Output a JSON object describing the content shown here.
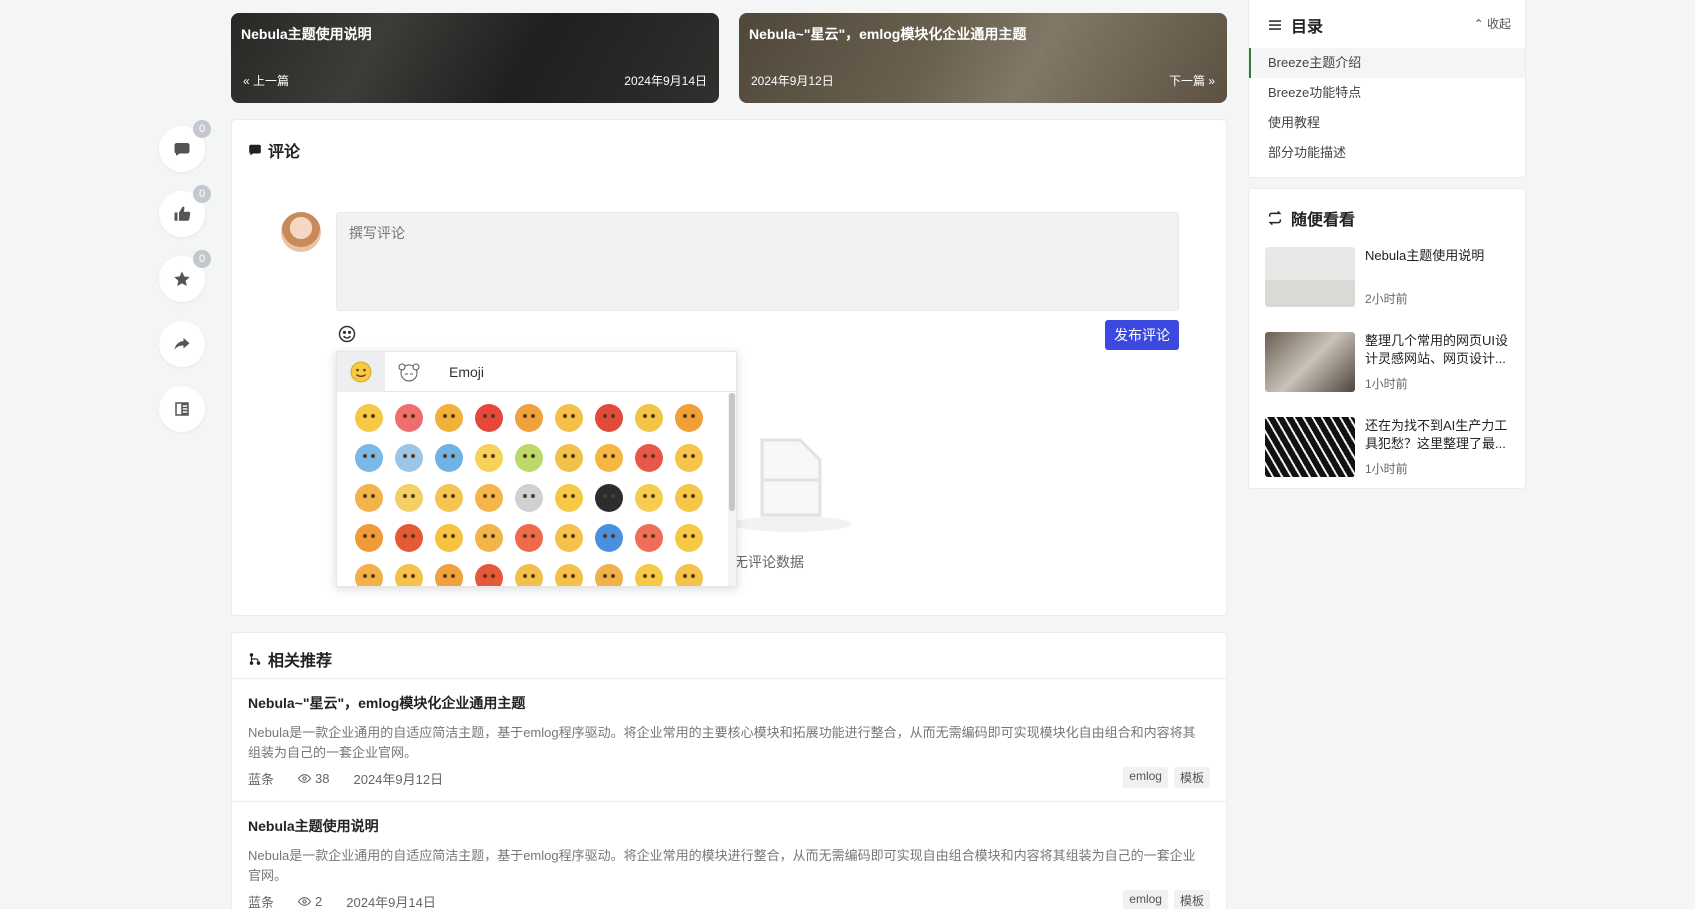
{
  "side_actions": [
    {
      "icon": "comment-icon",
      "badge": "0"
    },
    {
      "icon": "thumbs-up-icon",
      "badge": "0"
    },
    {
      "icon": "star-icon",
      "badge": "0"
    },
    {
      "icon": "share-icon",
      "badge": ""
    },
    {
      "icon": "reader-icon",
      "badge": ""
    }
  ],
  "prev_next": {
    "prev": {
      "title": "Nebula主题使用说明",
      "label": "« 上一篇",
      "date": "2024年9月14日"
    },
    "next": {
      "title": "Nebula~\"星云\"，emlog模块化企业通用主题",
      "date": "2024年9月12日",
      "label": "下一篇 »"
    }
  },
  "comments": {
    "title": "评论",
    "placeholder": "撰写评论",
    "submit_label": "发布评论",
    "empty_text": "暂无评论数据"
  },
  "emoji_panel": {
    "tab_label": "Emoji",
    "colors": [
      "#f6c945",
      "#f06d6d",
      "#f2b13a",
      "#e5483a",
      "#f0a23c",
      "#f5c04a",
      "#e24a3a",
      "#f3c546",
      "#f0a035",
      "#7ab8e8",
      "#9bc6e8",
      "#6fb2e6",
      "#f7d25a",
      "#bcd96a",
      "#f2c14c",
      "#f4b842",
      "#e8584a",
      "#f6c44b",
      "#f2b44a",
      "#f4cf66",
      "#f6c450",
      "#f5b54c",
      "#cfcfd4",
      "#f6c945",
      "#2d2d2d",
      "#f6cd50",
      "#f6c648",
      "#f09a3a",
      "#e45a32",
      "#f6c340",
      "#f2b54a",
      "#ef6a4a",
      "#f5c04c",
      "#4a8fe0",
      "#f06d5a",
      "#f6c945",
      "#f4b048",
      "#f6c14a",
      "#f0a23c",
      "#e5583a",
      "#f2c04a",
      "#f5c04a",
      "#f1b14a",
      "#f6c945",
      "#f4c24a"
    ]
  },
  "related": {
    "title": "相关推荐",
    "items": [
      {
        "title": "Nebula~\"星云\"，emlog模块化企业通用主题",
        "desc": "Nebula是一款企业通用的自适应简洁主题，基于emlog程序驱动。将企业常用的主要核心模块和拓展功能进行整合，从而无需编码即可实现模块化自由组合和内容将其组装为自己的一套企业官网。",
        "author": "蓝条",
        "views": "38",
        "date": "2024年9月12日",
        "tags": [
          "emlog",
          "模板"
        ]
      },
      {
        "title": "Nebula主题使用说明",
        "desc": "Nebula是一款企业通用的自适应简洁主题，基于emlog程序驱动。将企业常用的模块进行整合，从而无需编码即可实现自由组合模块和内容将其组装为自己的一套企业官网。",
        "author": "蓝条",
        "views": "2",
        "date": "2024年9月14日",
        "tags": [
          "emlog",
          "模板"
        ]
      }
    ]
  },
  "toc": {
    "title": "目录",
    "collapse_label": "⌃ 收起",
    "items": [
      "Breeze主题介绍",
      "Breeze功能特点",
      "使用教程",
      "部分功能描述"
    ]
  },
  "random": {
    "title": "随便看看",
    "items": [
      {
        "title": "Nebula主题使用说明",
        "time": "2小时前"
      },
      {
        "title": "整理几个常用的网页UI设计灵感网站、网页设计...",
        "time": "1小时前"
      },
      {
        "title": "还在为找不到AI生产力工具犯愁？这里整理了最...",
        "time": "1小时前"
      }
    ]
  },
  "colors": {
    "accent": "#3c49e0",
    "toc_active": "#2e7d32"
  }
}
